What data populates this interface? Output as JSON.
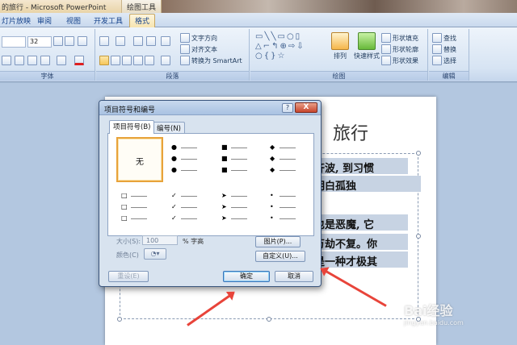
{
  "window": {
    "title": "的旅行 - Microsoft PowerPoint",
    "context_tab": "绘图工具"
  },
  "tabs": [
    "灯片放映",
    "审阅",
    "视图",
    "开发工具",
    "格式"
  ],
  "ribbon": {
    "font": {
      "font_size": "32",
      "group_label": "字体"
    },
    "paragraph": {
      "text_direction": "文字方向",
      "align_text": "对齐文本",
      "convert_smartart": "转换为 SmartArt",
      "group_label": "段落"
    },
    "drawing": {
      "arrange": "排列",
      "quick_styles": "快速样式",
      "shape_fill": "形状填充",
      "shape_outline": "形状轮廓",
      "shape_effects": "形状效果",
      "group_label": "绘图"
    },
    "editing": {
      "find": "查找",
      "replace": "替换",
      "select": "选择",
      "group_label": "编辑"
    }
  },
  "slide": {
    "title_fragment": "旅行",
    "lines": [
      "齐波, 到习惯",
      "明白孤独",
      "也是恶魔, 它",
      "万劫不复。你",
      "是一种才极其"
    ]
  },
  "dialog": {
    "title": "项目符号和编号",
    "help": "?",
    "close": "X",
    "tabs": [
      "项目符号(B)",
      "编号(N)"
    ],
    "none_label": "无",
    "bullet_styles": [
      {
        "glyph": "●"
      },
      {
        "glyph": "■"
      },
      {
        "glyph": "◆"
      },
      {
        "glyph": "□"
      },
      {
        "glyph": "✓"
      },
      {
        "glyph": "➤"
      },
      {
        "glyph": "•"
      }
    ],
    "size_label": "大小(S):",
    "size_value": "100",
    "size_unit": "% 字高",
    "color_label": "颜色(C)",
    "picture_button": "图片(P)...",
    "customize_button": "自定义(U)...",
    "reset_button": "重设(E)",
    "ok_button": "确定",
    "cancel_button": "取消"
  },
  "watermark": {
    "brand": "Bai经验",
    "url": "jingyan.baidu.com"
  },
  "colors": {
    "accent_arrow": "#e8443a",
    "selection_orange": "#e8a33b"
  }
}
